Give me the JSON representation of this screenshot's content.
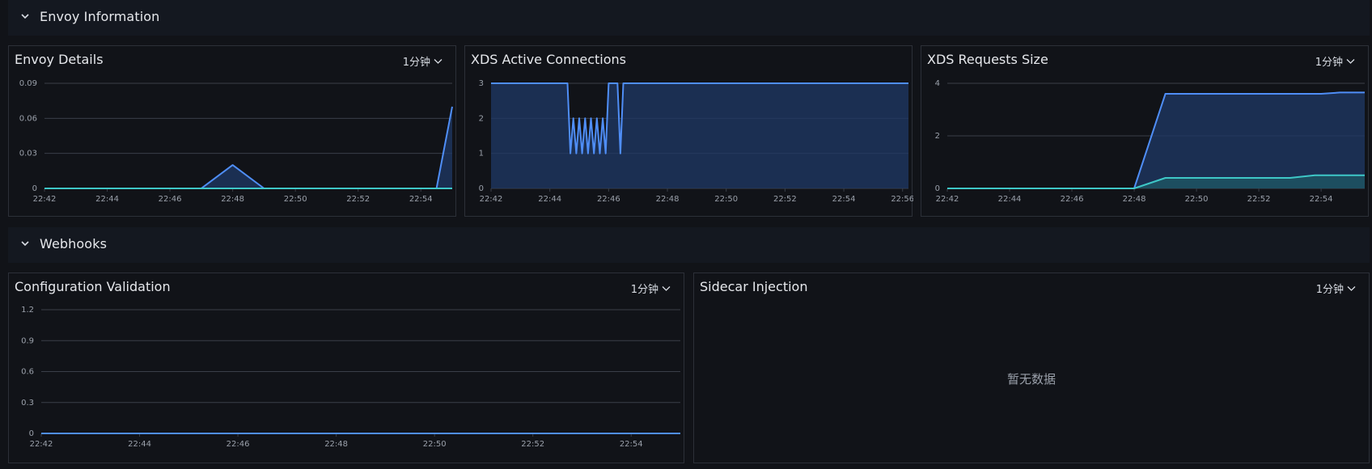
{
  "sections": [
    {
      "title": "Envoy Information"
    },
    {
      "title": "Webhooks"
    }
  ],
  "panels": {
    "envoy_details": {
      "title": "Envoy Details",
      "interval": "1分钟"
    },
    "xds_active": {
      "title": "XDS Active Connections"
    },
    "xds_requests": {
      "title": "XDS Requests Size",
      "interval": "1分钟"
    },
    "config_validation": {
      "title": "Configuration Validation",
      "interval": "1分钟"
    },
    "sidecar_injection": {
      "title": "Sidecar Injection",
      "interval": "1分钟",
      "empty_text": "暂无数据"
    }
  },
  "colors": {
    "series_blue": "#4f8ef7",
    "series_teal": "#3ec7c7",
    "fill_blue": "#1f3a66",
    "fill_teal": "#1f5a66",
    "grid": "#3a3f48"
  },
  "chart_data": [
    {
      "id": "envoy_details",
      "type": "area",
      "xticks": [
        "22:42",
        "22:44",
        "22:46",
        "22:48",
        "22:50",
        "22:52",
        "22:54"
      ],
      "yticks": [
        "0",
        "0.03",
        "0.06",
        "0.09"
      ],
      "ylim": [
        0,
        0.09
      ],
      "xlim": [
        0,
        13
      ],
      "series": [
        {
          "color": "blue",
          "points": [
            [
              0,
              0
            ],
            [
              5,
              0
            ],
            [
              6,
              0.02
            ],
            [
              7,
              0
            ],
            [
              12.5,
              0
            ],
            [
              13,
              0.07
            ]
          ]
        },
        {
          "color": "teal",
          "points": [
            [
              0,
              0
            ],
            [
              13,
              0
            ]
          ]
        }
      ]
    },
    {
      "id": "xds_active",
      "type": "area",
      "xticks": [
        "22:42",
        "22:44",
        "22:46",
        "22:48",
        "22:50",
        "22:52",
        "22:54",
        "22:56"
      ],
      "yticks": [
        "0",
        "1",
        "2",
        "3"
      ],
      "ylim": [
        0,
        3
      ],
      "xlim": [
        0,
        14.2
      ],
      "series": [
        {
          "color": "blue",
          "points": [
            [
              0,
              3
            ],
            [
              2.6,
              3
            ],
            [
              2.7,
              1
            ],
            [
              2.8,
              2
            ],
            [
              2.9,
              1
            ],
            [
              3.0,
              2
            ],
            [
              3.1,
              1
            ],
            [
              3.2,
              2
            ],
            [
              3.3,
              1
            ],
            [
              3.4,
              2
            ],
            [
              3.5,
              1
            ],
            [
              3.6,
              2
            ],
            [
              3.7,
              1
            ],
            [
              3.8,
              2
            ],
            [
              3.9,
              1
            ],
            [
              4.0,
              3
            ],
            [
              4.3,
              3
            ],
            [
              4.4,
              1
            ],
            [
              4.5,
              3
            ],
            [
              14.2,
              3
            ]
          ]
        }
      ]
    },
    {
      "id": "xds_requests",
      "type": "area",
      "xticks": [
        "22:42",
        "22:44",
        "22:46",
        "22:48",
        "22:50",
        "22:52",
        "22:54"
      ],
      "yticks": [
        "0",
        "2",
        "4"
      ],
      "ylim": [
        0,
        4
      ],
      "xlim": [
        0,
        13.4
      ],
      "series": [
        {
          "color": "blue",
          "points": [
            [
              0,
              0
            ],
            [
              6,
              0
            ],
            [
              7,
              3.6
            ],
            [
              12,
              3.6
            ],
            [
              12.6,
              3.65
            ],
            [
              13.4,
              3.65
            ]
          ]
        },
        {
          "color": "teal",
          "points": [
            [
              0,
              0
            ],
            [
              6,
              0
            ],
            [
              7,
              0.4
            ],
            [
              11,
              0.4
            ],
            [
              11.8,
              0.5
            ],
            [
              13.4,
              0.5
            ]
          ]
        }
      ]
    },
    {
      "id": "config_validation",
      "type": "line",
      "xticks": [
        "22:42",
        "22:44",
        "22:46",
        "22:48",
        "22:50",
        "22:52",
        "22:54"
      ],
      "yticks": [
        "0",
        "0.3",
        "0.6",
        "0.9",
        "1.2"
      ],
      "ylim": [
        0,
        1.2
      ],
      "xlim": [
        0,
        13
      ],
      "series": [
        {
          "color": "blue",
          "points": [
            [
              0,
              0
            ],
            [
              13,
              0
            ]
          ]
        }
      ]
    }
  ]
}
